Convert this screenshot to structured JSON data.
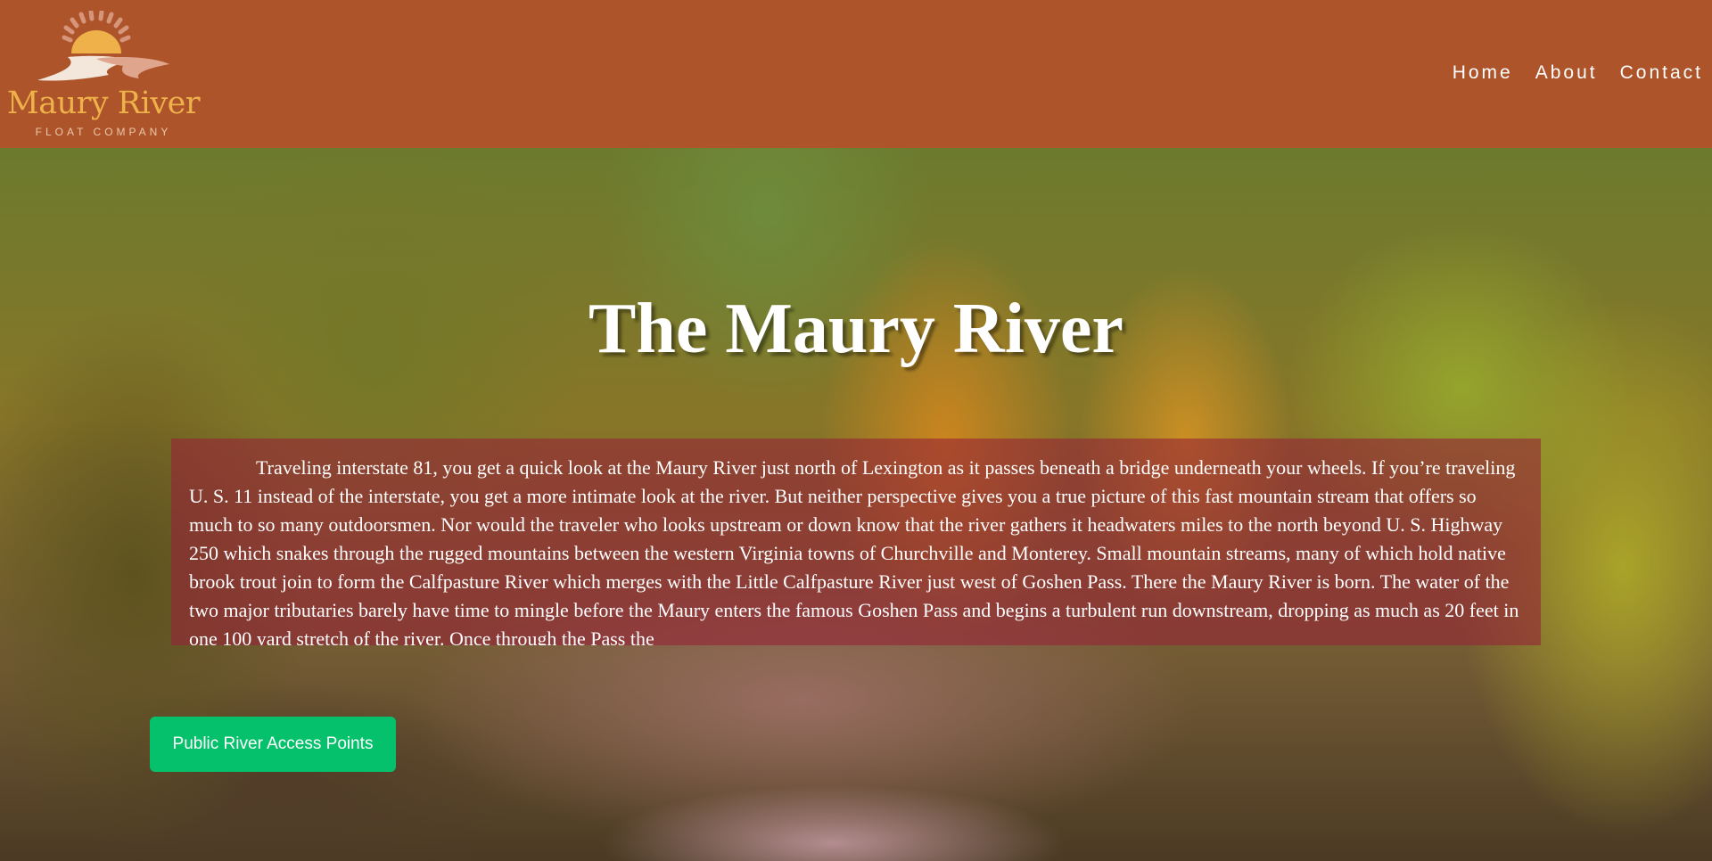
{
  "header": {
    "logo_name": "Maury River",
    "logo_tagline": "FLOAT COMPANY",
    "logo_icon": "sun-over-river-icon",
    "nav": [
      "Home",
      "About",
      "Contact"
    ]
  },
  "hero": {
    "title": "The Maury River",
    "intro": "Traveling interstate 81, you get a quick look at the Maury River just north of Lexington as it passes beneath a bridge underneath your wheels. If you’re traveling U. S. 11 instead of the interstate, you get a more intimate look at the river. But neither perspective gives you a true picture of this fast mountain stream that offers so much to so many outdoorsmen. Nor would the traveler who looks upstream or down know that the river gathers it headwaters miles to the north beyond U. S. Highway 250 which snakes through the rugged mountains between the western Virginia towns of Churchville and Monterey. Small mountain streams, many of which hold native brook trout join to form the Calfpasture River which merges with the Little Calfpasture River just west of Goshen Pass. There the Maury River is born. The water of the two major tributaries barely have time to mingle before the Maury enters the famous Goshen Pass and begins a turbulent run downstream, dropping as much as 20 feet in one 100 yard stretch of the river. Once through the Pass the",
    "cta_label": "Public River Access Points"
  },
  "colors": {
    "header_bg": "#ad542b",
    "logo_gold": "#efb24a",
    "text_box": "rgba(150, 35, 55, 0.60)",
    "cta": "#06c16b"
  }
}
